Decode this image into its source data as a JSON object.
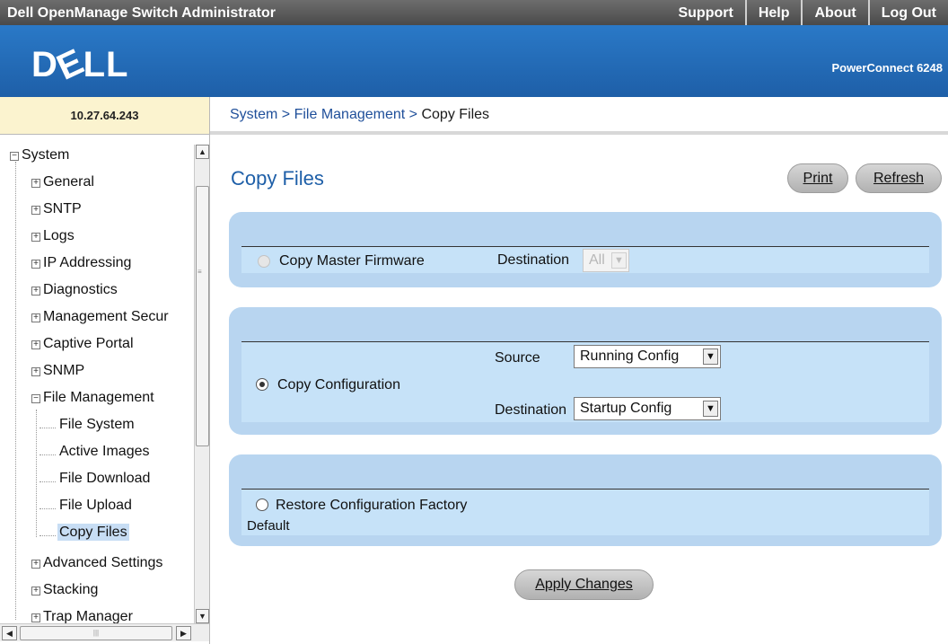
{
  "header": {
    "app_title": "Dell OpenManage Switch Administrator",
    "links": [
      "Support",
      "Help",
      "About",
      "Log Out"
    ],
    "logo": "DELL",
    "model": "PowerConnect 6248"
  },
  "ip_address": "10.27.64.243",
  "breadcrumb": {
    "items": [
      "System",
      "File Management",
      "Copy Files"
    ],
    "separator": ">"
  },
  "tree": {
    "root": "System",
    "items": {
      "general": "General",
      "sntp": "SNTP",
      "logs": "Logs",
      "ip_addressing": "IP Addressing",
      "diagnostics": "Diagnostics",
      "management_security": "Management Secur",
      "captive_portal": "Captive Portal",
      "snmp": "SNMP",
      "file_management": "File Management",
      "file_system": "File System",
      "active_images": "Active Images",
      "file_download": "File Download",
      "file_upload": "File Upload",
      "copy_files": "Copy Files",
      "advanced_settings": "Advanced Settings",
      "stacking": "Stacking",
      "trap_manager": "Trap Manager"
    },
    "expand_glyph": "+",
    "collapse_glyph": "−"
  },
  "page": {
    "title": "Copy Files",
    "print_label": "Print",
    "refresh_label": "Refresh",
    "firmware": {
      "label": "Copy Master Firmware",
      "destination_label": "Destination",
      "destination_value": "All"
    },
    "config": {
      "label": "Copy Configuration",
      "source_label": "Source",
      "source_value": "Running Config",
      "destination_label": "Destination",
      "destination_value": "Startup Config"
    },
    "restore": {
      "label_line1": "Restore Configuration Factory",
      "label_line2": "Default"
    },
    "apply_label": "Apply Changes"
  },
  "colors": {
    "brand_blue": "#1e5fa8",
    "panel_blue": "#b8d5f0",
    "inner_blue": "#c6e2f8",
    "ip_background": "#fbf3cf"
  }
}
